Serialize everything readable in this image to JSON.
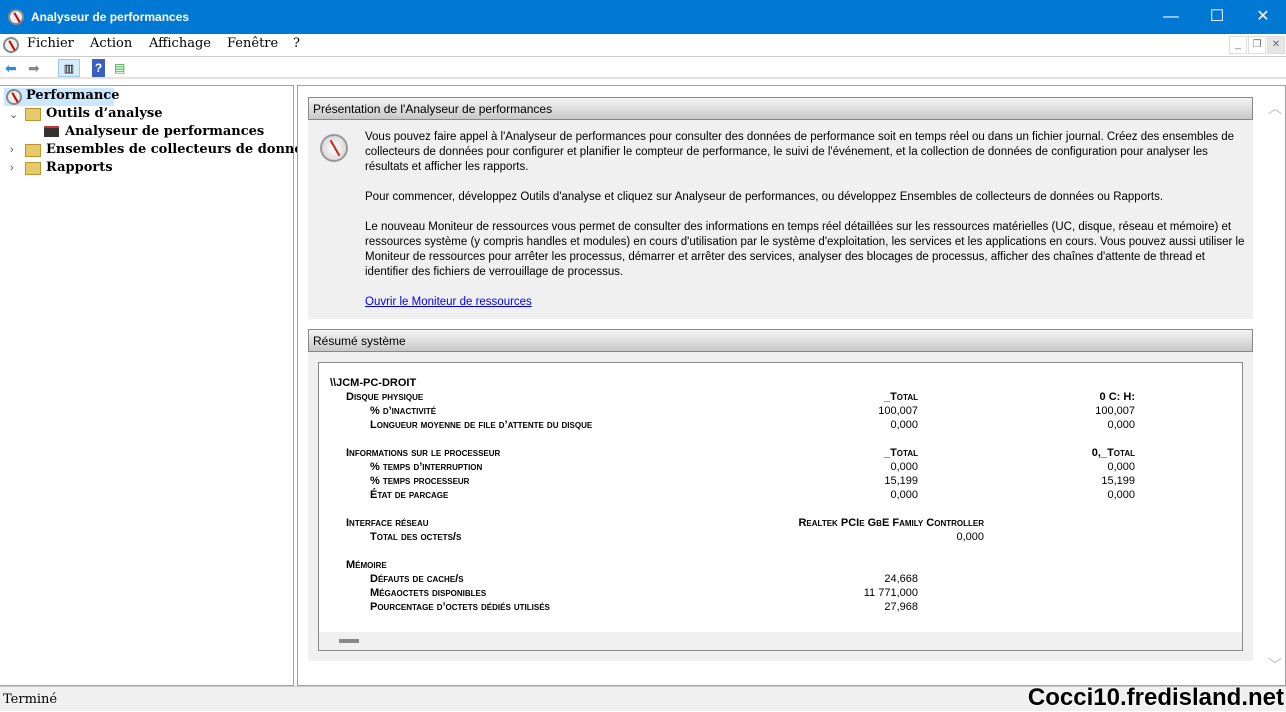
{
  "window": {
    "title": "Analyseur de performances",
    "minimize": "—",
    "maximize": "☐",
    "close": "✕"
  },
  "menu": [
    "Fichier",
    "Action",
    "Affichage",
    "Fenêtre",
    "?"
  ],
  "mdi": {
    "minimize": "_",
    "restore": "❐",
    "close": "✕"
  },
  "tree": {
    "root": "Performance",
    "items": [
      "Outils d’analyse",
      "Analyseur de performances",
      "Ensembles de collecteurs de données",
      "Rapports"
    ]
  },
  "overview": {
    "header": "Présentation de l'Analyseur de performances",
    "paragraphs": [
      "Vous pouvez faire appel à l'Analyseur de performances pour consulter des données de performance soit en temps réel ou dans un fichier journal. Créez des ensembles de collecteurs de données pour configurer et planifier le compteur de performance, le suivi de l'événement, et la collection de données de configuration pour analyser les résultats et afficher les rapports.",
      "Pour commencer, développez Outils d'analyse et cliquez sur Analyseur de performances, ou développez Ensembles de collecteurs de données ou Rapports.",
      "Le nouveau Moniteur de ressources vous permet de consulter des informations en temps réel détaillées sur les ressources matérielles (UC, disque, réseau et mémoire) et ressources système (y compris handles et modules) en cours d'utilisation par le système d'exploitation, les services et les applications en cours. Vous pouvez aussi utiliser le Moniteur de ressources pour arrêter les processus, démarrer et arrêter des services, analyser des blocages de processus, afficher des chaînes d'attente de thread et identifier des fichiers de verrouillage de processus."
    ],
    "link": "Ouvrir le Moniteur de ressources"
  },
  "summary": {
    "header": "Résumé système",
    "machine": "\\\\JCM-PC-DROIT",
    "disk": {
      "title": "Disque physique",
      "c1": "_Total",
      "c2": "0 C: H:",
      "rows": [
        [
          "% d’inactivité",
          "100,007",
          "100,007"
        ],
        [
          "Longueur moyenne de file d’attente du disque",
          "0,000",
          "0,000"
        ]
      ]
    },
    "cpu": {
      "title": "Informations sur le processeur",
      "c1": "_Total",
      "c2": "0,_Total",
      "rows": [
        [
          "% temps d’interruption",
          "0,000",
          "0,000"
        ],
        [
          "% temps processeur",
          "15,199",
          "15,199"
        ],
        [
          "État de parcage",
          "0,000",
          "0,000"
        ]
      ]
    },
    "net": {
      "title": "Interface réseau",
      "c1": "Realtek PCIe GbE Family Controller",
      "rows": [
        [
          "Total des octets/s",
          "0,000"
        ]
      ]
    },
    "mem": {
      "title": "Mémoire",
      "rows": [
        [
          "Défauts de cache/s",
          "24,668"
        ],
        [
          "Mégaoctets disponibles",
          "11 771,000"
        ],
        [
          "Pourcentage d’octets dédiés utilisés",
          "27,968"
        ]
      ]
    }
  },
  "status": "Terminé",
  "watermark": "Cocci10.fredisland.net"
}
